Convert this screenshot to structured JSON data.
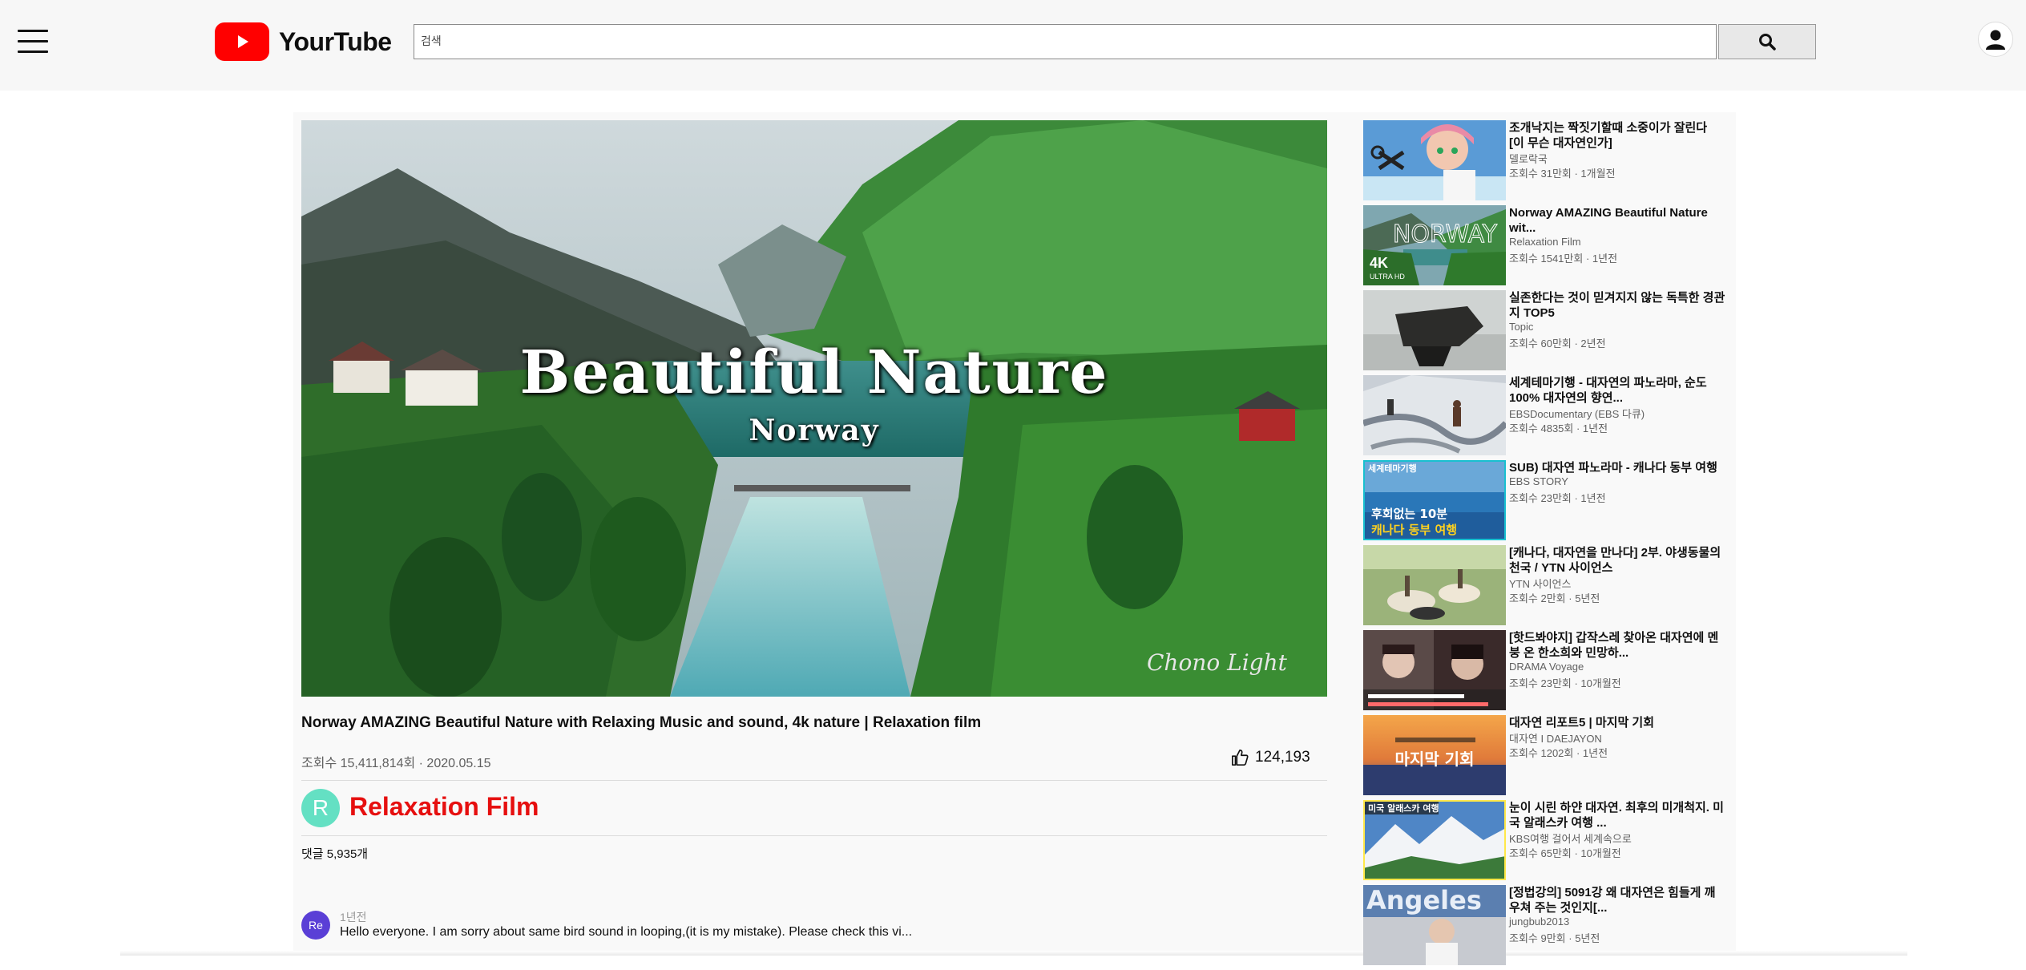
{
  "header": {
    "logo_text": "YourTube",
    "search_placeholder": "검색",
    "search_icon": "search-icon",
    "menu_icon": "hamburger-menu-icon",
    "account_icon": "account-icon",
    "brand_color": "#ff0000"
  },
  "video": {
    "overlay_title": "Beautiful Nature",
    "overlay_subtitle": "Norway",
    "watermark": "Chono Light",
    "title": "Norway AMAZING Beautiful Nature with Relaxing Music and sound, 4k nature | Relaxation film",
    "meta": "조회수 15,411,814회 · 2020.05.15",
    "likes": "124,193",
    "like_icon": "thumbs-up-icon"
  },
  "channel": {
    "avatar_letter": "R",
    "name": "Relaxation Film",
    "name_color": "#e60f0f"
  },
  "comments": {
    "count_label": "댓글 5,935개",
    "items": [
      {
        "avatar": "Re",
        "time": "1년전",
        "text": "Hello everyone. I am sorry about same bird sound in looping,(it is my mistake). Please check this vi..."
      }
    ]
  },
  "recommendations": [
    {
      "title": "조개낙지는 짝짓기할때 소중이가 잘린다 [이 무슨 대자연인가]",
      "channel": "델로락국",
      "meta": "조회수 31만회 · 1개월전"
    },
    {
      "title": "Norway AMAZING Beautiful Nature wit...",
      "channel": "Relaxation Film",
      "meta": "조회수 1541만회 · 1년전",
      "thumb_big": "NORWAY",
      "thumb_tag": "4K",
      "thumb_small": "ULTRA HD"
    },
    {
      "title": "실존한다는 것이 믿겨지지 않는 독특한 경관지 TOP5",
      "channel": "Topic",
      "meta": "조회수 60만회 · 2년전"
    },
    {
      "title": "세계테마기행 - 대자연의 파노라마, 순도 100% 대자연의 향연...",
      "channel": "EBSDocumentary (EBS 다큐)",
      "meta": "조회수 4835회 · 1년전"
    },
    {
      "title": "SUB) 대자연 파노라마 - 캐나다 동부 여행",
      "channel": "EBS STORY",
      "meta": "조회수 23만회 · 1년전",
      "thumb_label": "세계테마기행",
      "thumb_line1": "후회없는 10분",
      "thumb_line2": "캐나다 동부 여행"
    },
    {
      "title": "[캐나다, 대자연을 만나다] 2부. 야생동물의 천국 / YTN 사이언스",
      "channel": "YTN 사이언스",
      "meta": "조회수 2만회 · 5년전"
    },
    {
      "title": "[핫드봐야지] 갑작스레 찾아온 대자연에 멘붕 온 한소희와 민망하...",
      "channel": "DRAMA Voyage",
      "meta": "조회수 23만회 · 10개월전"
    },
    {
      "title": "대자연 리포트5 | 마지막 기회",
      "channel": "대자연 I DAEJAYON",
      "meta": "조회수 1202회 · 1년전",
      "thumb_text": "마지막 기회"
    },
    {
      "title": "눈이 시린 하얀 대자연. 최후의 미개척지. 미국 알래스카 여행 ...",
      "channel": "KBS여행 걸어서 세계속으로",
      "meta": "조회수 65만회 · 10개월전",
      "thumb_label": "미국 알래스카 여행"
    },
    {
      "title": "[정법강의] 5091강 왜 대자연은 힘들게 깨우쳐 주는 것인지[...",
      "channel": "jungbub2013",
      "meta": "조회수 9만회 · 5년전",
      "thumb_text": "Angeles"
    }
  ]
}
